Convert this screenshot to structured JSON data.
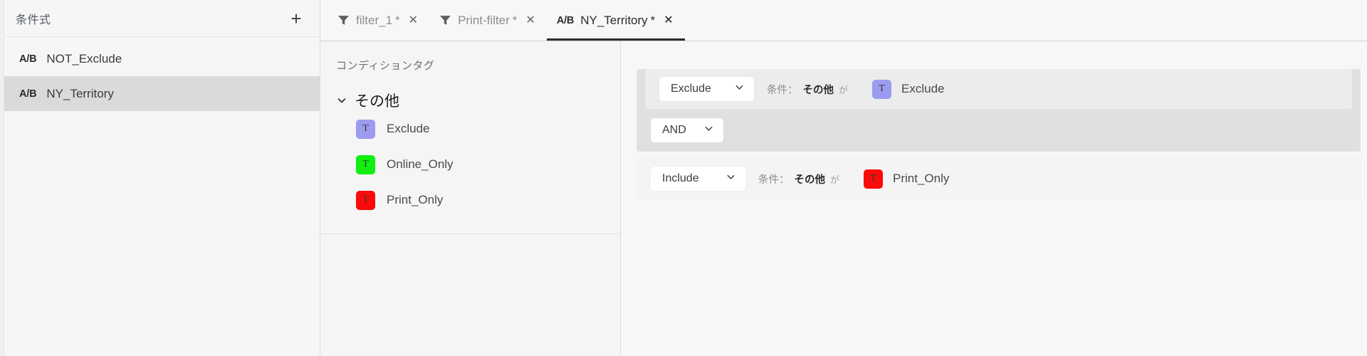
{
  "sidebar": {
    "title": "条件式",
    "add_button_label": "+",
    "items": [
      {
        "type": "A/B",
        "label": "NOT_Exclude",
        "selected": false
      },
      {
        "type": "A/B",
        "label": "NY_Territory",
        "selected": true
      }
    ]
  },
  "tabs": [
    {
      "icon": "filter-icon",
      "type": "",
      "label": "filter_1",
      "dirty": "*",
      "close": "✕",
      "active": false
    },
    {
      "icon": "filter-icon",
      "type": "",
      "label": "Print-filter",
      "dirty": "*",
      "close": "✕",
      "active": false
    },
    {
      "icon": "",
      "type": "A/B",
      "label": "NY_Territory",
      "dirty": "*",
      "close": "✕",
      "active": true
    }
  ],
  "tag_panel": {
    "header": "コンディションタグ",
    "group": {
      "label": "その他",
      "expanded": true,
      "chevron": "chevron-down-icon"
    },
    "tags": [
      {
        "letter": "T",
        "name": "Exclude",
        "color": "#9b9bf0"
      },
      {
        "letter": "T",
        "name": "Online_Only",
        "color": "#10ef10"
      },
      {
        "letter": "T",
        "name": "Print_Only",
        "color": "#fa0a0a"
      }
    ]
  },
  "rules": {
    "group": {
      "rows": [
        {
          "mode": "Exclude",
          "cond_prefix": "条件：",
          "cond_group": "その他",
          "cond_suffix": "が",
          "tag_letter": "T",
          "tag_name": "Exclude",
          "tag_color": "#9b9bf0"
        }
      ],
      "operator": "AND"
    },
    "standalone": {
      "mode": "Include",
      "cond_prefix": "条件：",
      "cond_group": "その他",
      "cond_suffix": "が",
      "tag_letter": "T",
      "tag_name": "Print_Only",
      "tag_color": "#fa0a0a"
    }
  }
}
